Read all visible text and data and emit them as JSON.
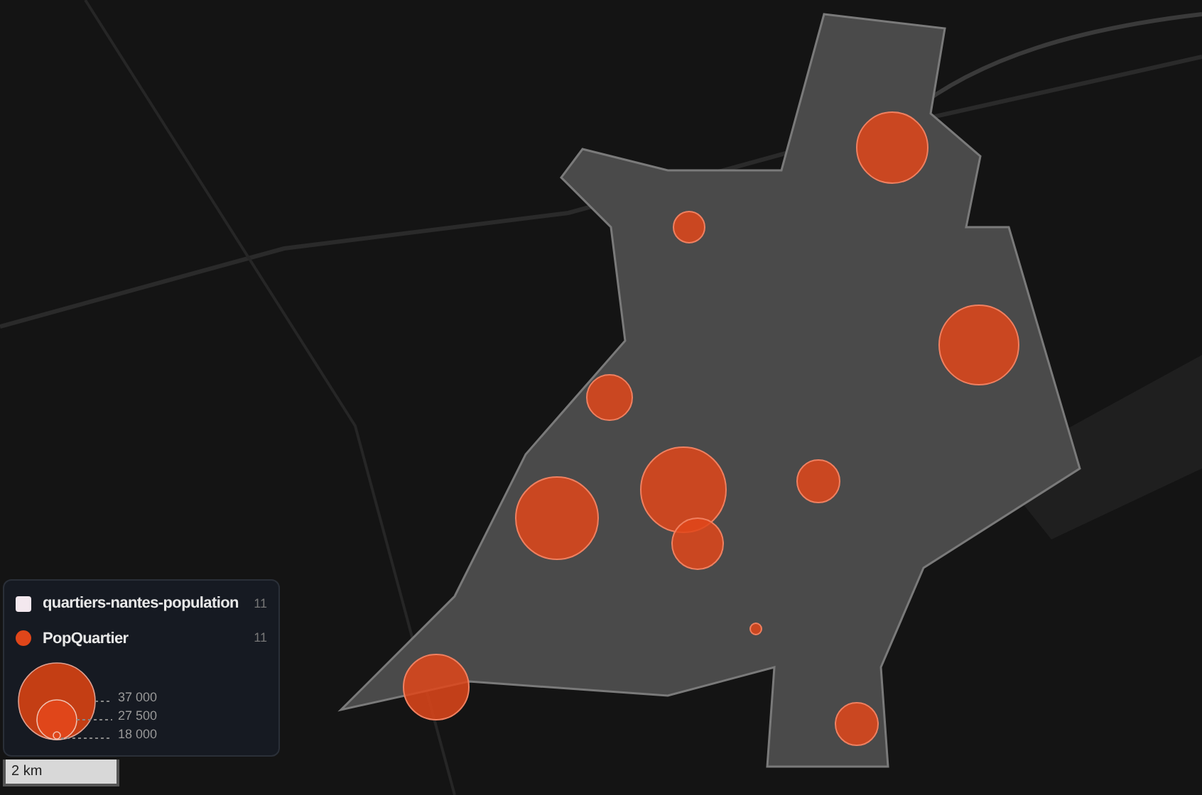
{
  "legend": {
    "layers": [
      {
        "name": "quartiers-nantes-population",
        "count": "11",
        "color": "#f3e8ee",
        "kind": "polygon"
      },
      {
        "name": "PopQuartier",
        "count": "11",
        "color": "#e0461a",
        "kind": "point"
      }
    ],
    "size_legend": [
      {
        "label": "37 000"
      },
      {
        "label": "27 500"
      },
      {
        "label": "18 000"
      }
    ]
  },
  "scale_bar": {
    "label": "2 km"
  }
}
